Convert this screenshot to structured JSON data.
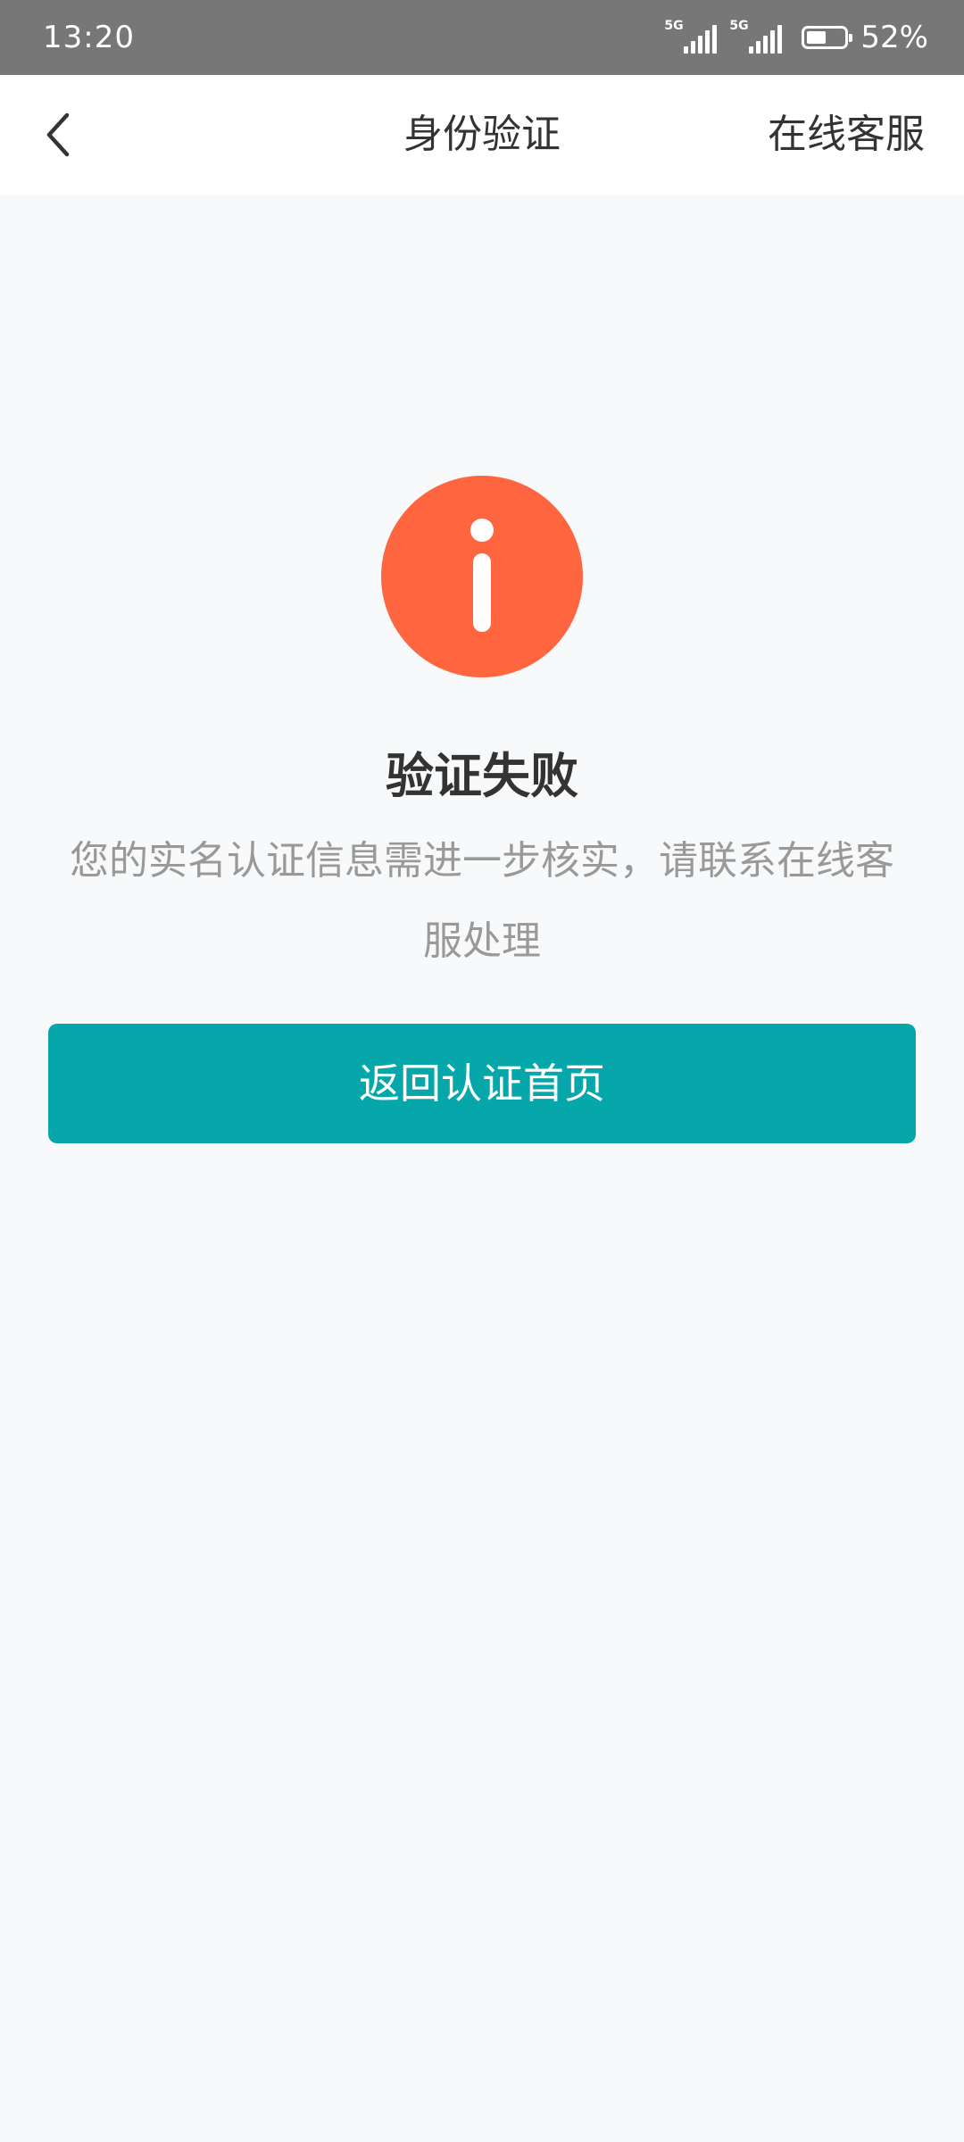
{
  "status_bar": {
    "time": "13:20",
    "network_1": "5G",
    "network_2": "5G",
    "battery_percent": "52%",
    "battery_level": 0.52
  },
  "nav": {
    "title": "身份验证",
    "right_action": "在线客服",
    "back_icon": "chevron-left-icon"
  },
  "result": {
    "icon": "info-icon",
    "icon_color": "#ff653e",
    "title": "验证失败",
    "description": "您的实名认证信息需进一步核实，请联系在线客服处理"
  },
  "actions": {
    "return_label": "返回认证首页",
    "button_color": "#06a7aa"
  }
}
